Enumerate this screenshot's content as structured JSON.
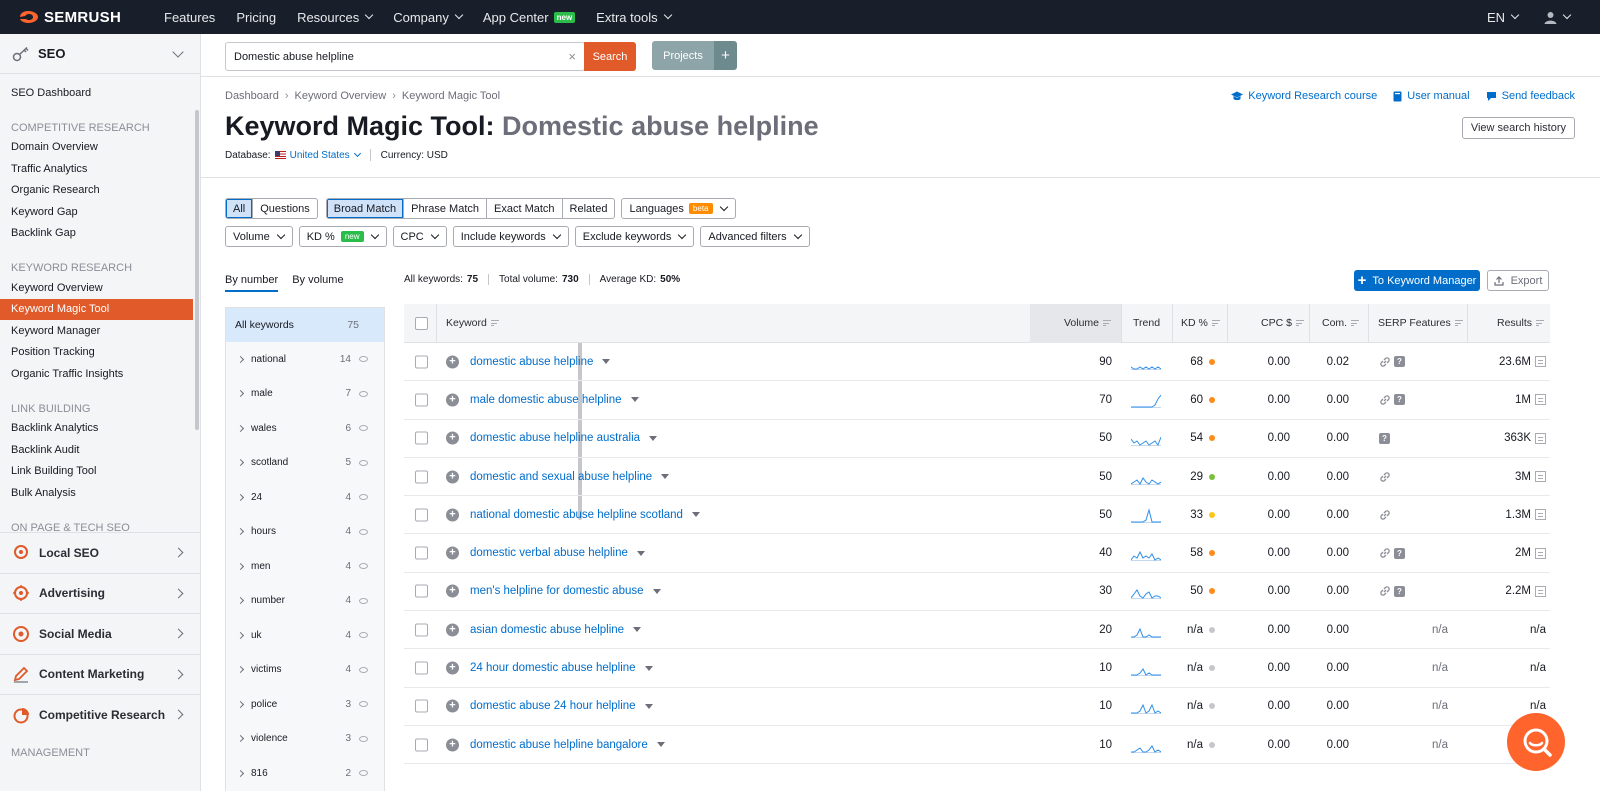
{
  "topbar": {
    "brand": "SEMRUSH",
    "nav": [
      {
        "label": "Features",
        "chevron": false
      },
      {
        "label": "Pricing",
        "chevron": false
      },
      {
        "label": "Resources",
        "chevron": true
      },
      {
        "label": "Company",
        "chevron": true
      },
      {
        "label": "App Center",
        "chevron": false,
        "badge": "new"
      },
      {
        "label": "Extra tools",
        "chevron": true
      }
    ],
    "language": "EN"
  },
  "sidebar": {
    "section_title": "SEO",
    "items": [
      {
        "type": "item",
        "label": "SEO Dashboard"
      },
      {
        "type": "cat",
        "label": "COMPETITIVE RESEARCH"
      },
      {
        "type": "item",
        "label": "Domain Overview"
      },
      {
        "type": "item",
        "label": "Traffic Analytics"
      },
      {
        "type": "item",
        "label": "Organic Research"
      },
      {
        "type": "item",
        "label": "Keyword Gap"
      },
      {
        "type": "item",
        "label": "Backlink Gap"
      },
      {
        "type": "cat",
        "label": "KEYWORD RESEARCH"
      },
      {
        "type": "item",
        "label": "Keyword Overview"
      },
      {
        "type": "item",
        "label": "Keyword Magic Tool",
        "active": true
      },
      {
        "type": "item",
        "label": "Keyword Manager"
      },
      {
        "type": "item",
        "label": "Position Tracking"
      },
      {
        "type": "item",
        "label": "Organic Traffic Insights"
      },
      {
        "type": "cat",
        "label": "LINK BUILDING"
      },
      {
        "type": "item",
        "label": "Backlink Analytics"
      },
      {
        "type": "item",
        "label": "Backlink Audit"
      },
      {
        "type": "item",
        "label": "Link Building Tool"
      },
      {
        "type": "item",
        "label": "Bulk Analysis"
      },
      {
        "type": "cat",
        "label": "ON PAGE & TECH SEO"
      }
    ],
    "sections": [
      {
        "label": "Local SEO",
        "icon": "location-pin-icon"
      },
      {
        "label": "Advertising",
        "icon": "target-icon"
      },
      {
        "label": "Social Media",
        "icon": "chat-bubble-icon"
      },
      {
        "label": "Content Marketing",
        "icon": "pencil-icon"
      },
      {
        "label": "Competitive Research",
        "icon": "pie-chart-icon"
      }
    ],
    "footer_cat": "MANAGEMENT"
  },
  "search": {
    "value": "Domestic abuse helpline",
    "clear": "×",
    "button": "Search",
    "projects": "Projects",
    "projects_add": "+"
  },
  "header": {
    "breadcrumb": [
      "Dashboard",
      "Keyword Overview",
      "Keyword Magic Tool"
    ],
    "title_prefix": "Keyword Magic Tool:",
    "title_query": "Domestic abuse helpline",
    "database_label": "Database:",
    "database_value": "United States",
    "currency": "Currency: USD",
    "links": [
      "Keyword Research course",
      "User manual",
      "Send feedback"
    ],
    "history_button": "View search history"
  },
  "filters": {
    "type_segment": [
      "All",
      "Questions"
    ],
    "match_segment": [
      "Broad Match",
      "Phrase Match",
      "Exact Match",
      "Related"
    ],
    "languages": "Languages",
    "languages_badge": "beta",
    "row2": [
      "Volume",
      "KD %",
      "CPC",
      "Include keywords",
      "Exclude keywords",
      "Advanced filters"
    ],
    "kd_badge": "new"
  },
  "groups": {
    "tabs": [
      "By number",
      "By volume"
    ],
    "all_label": "All keywords",
    "all_count": "75",
    "items": [
      {
        "label": "national",
        "count": "14"
      },
      {
        "label": "male",
        "count": "7"
      },
      {
        "label": "wales",
        "count": "6"
      },
      {
        "label": "scotland",
        "count": "5"
      },
      {
        "label": "24",
        "count": "4"
      },
      {
        "label": "hours",
        "count": "4"
      },
      {
        "label": "men",
        "count": "4"
      },
      {
        "label": "number",
        "count": "4"
      },
      {
        "label": "uk",
        "count": "4"
      },
      {
        "label": "victims",
        "count": "4"
      },
      {
        "label": "police",
        "count": "3"
      },
      {
        "label": "violence",
        "count": "3"
      },
      {
        "label": "816",
        "count": "2"
      }
    ]
  },
  "stats": {
    "all_keywords_label": "All keywords:",
    "all_keywords": "75",
    "total_volume_label": "Total volume:",
    "total_volume": "730",
    "avg_kd_label": "Average KD:",
    "avg_kd": "50%"
  },
  "actions": {
    "to_keyword_manager": "To Keyword Manager",
    "export": "Export"
  },
  "table": {
    "columns": [
      "Keyword",
      "Volume",
      "Trend",
      "KD %",
      "CPC $",
      "Com.",
      "SERP Features",
      "Results"
    ],
    "rows": [
      {
        "keyword": "domestic abuse helpline",
        "volume": "90",
        "kd": "68",
        "kd_color": "#ff8c1a",
        "cpc": "0.00",
        "com": "0.02",
        "serp": [
          "link",
          "question"
        ],
        "results": "23.6M",
        "trend": [
          6,
          7,
          7,
          6,
          7,
          6,
          7,
          6,
          7,
          6,
          7
        ]
      },
      {
        "keyword": "male domestic abuse helpline",
        "volume": "70",
        "kd": "60",
        "kd_color": "#ff8c1a",
        "cpc": "0.00",
        "com": "0.00",
        "serp": [
          "link",
          "question"
        ],
        "results": "1M",
        "trend": [
          7,
          7,
          7,
          7,
          7,
          7,
          7,
          7,
          6,
          3,
          1
        ]
      },
      {
        "keyword": "domestic abuse helpline australia",
        "volume": "50",
        "kd": "54",
        "kd_color": "#ff8c1a",
        "cpc": "0.00",
        "com": "0.00",
        "serp": [
          "question"
        ],
        "results": "363K",
        "trend": [
          4,
          6,
          5,
          7,
          6,
          5,
          7,
          6,
          5,
          7,
          3
        ]
      },
      {
        "keyword": "domestic and sexual abuse helpline",
        "volume": "50",
        "kd": "29",
        "kd_color": "#7bc03a",
        "cpc": "0.00",
        "com": "0.00",
        "serp": [
          "link"
        ],
        "results": "3M",
        "trend": [
          7,
          6,
          5,
          7,
          4,
          6,
          7,
          5,
          6,
          7,
          6
        ]
      },
      {
        "keyword": "national domestic abuse helpline scotland",
        "volume": "50",
        "kd": "33",
        "kd_color": "#ffc61a",
        "cpc": "0.00",
        "com": "0.00",
        "serp": [
          "link"
        ],
        "results": "1.3M",
        "trend": [
          7,
          7,
          7,
          7,
          7,
          6,
          1,
          7,
          7,
          7,
          7
        ]
      },
      {
        "keyword": "domestic verbal abuse helpline",
        "volume": "40",
        "kd": "58",
        "kd_color": "#ff8c1a",
        "cpc": "0.00",
        "com": "0.00",
        "serp": [
          "link",
          "question"
        ],
        "results": "2M",
        "trend": [
          7,
          5,
          6,
          3,
          6,
          5,
          6,
          4,
          7,
          6,
          7
        ]
      },
      {
        "keyword": "men's helpline for domestic abuse",
        "volume": "30",
        "kd": "50",
        "kd_color": "#ff8c1a",
        "cpc": "0.00",
        "com": "0.00",
        "serp": [
          "link",
          "question"
        ],
        "results": "2.2M",
        "trend": [
          7,
          5,
          3,
          6,
          7,
          5,
          4,
          7,
          6,
          6,
          7
        ]
      },
      {
        "keyword": "asian domestic abuse helpline",
        "volume": "20",
        "kd": "n/a",
        "kd_color": "#c5c7cc",
        "cpc": "0.00",
        "com": "0.00",
        "serp_text": "n/a",
        "results": "n/a",
        "trend": [
          7,
          7,
          6,
          3,
          7,
          7,
          6,
          7,
          7,
          7,
          7
        ]
      },
      {
        "keyword": "24 hour domestic abuse helpline",
        "volume": "10",
        "kd": "n/a",
        "kd_color": "#c5c7cc",
        "cpc": "0.00",
        "com": "0.00",
        "serp_text": "n/a",
        "results": "n/a",
        "trend": [
          7,
          7,
          7,
          6,
          4,
          7,
          6,
          7,
          7,
          7,
          7
        ]
      },
      {
        "keyword": "domestic abuse 24 hour helpline",
        "volume": "10",
        "kd": "n/a",
        "kd_color": "#c5c7cc",
        "cpc": "0.00",
        "com": "0.00",
        "serp_text": "n/a",
        "results": "n/a",
        "trend": [
          7,
          7,
          7,
          6,
          3,
          7,
          6,
          3,
          7,
          6,
          7
        ]
      },
      {
        "keyword": "domestic abuse helpline bangalore",
        "volume": "10",
        "kd": "n/a",
        "kd_color": "#c5c7cc",
        "cpc": "0.00",
        "com": "0.00",
        "serp_text": "n/a",
        "results": "n/a",
        "trend": [
          7,
          7,
          6,
          5,
          7,
          7,
          6,
          4,
          7,
          6,
          7
        ]
      }
    ]
  },
  "colors": {
    "brand_orange": "#ff642d",
    "active_item": "#e05a2a",
    "link_blue": "#006dca",
    "topbar": "#181e2a"
  }
}
